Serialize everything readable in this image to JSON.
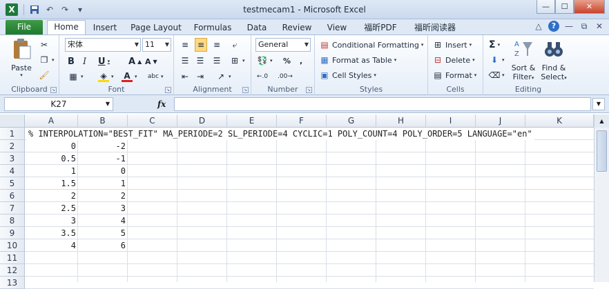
{
  "window": {
    "title": "testmecam1 - Microsoft Excel"
  },
  "app_icon": "X",
  "tabs": [
    "File",
    "Home",
    "Insert",
    "Page Layout",
    "Formulas",
    "Data",
    "Review",
    "View",
    "福昕PDF",
    "福昕阅读器"
  ],
  "clipboard": {
    "paste": "Paste",
    "label": "Clipboard"
  },
  "font": {
    "name": "宋体",
    "size": "11",
    "label": "Font"
  },
  "alignment": {
    "label": "Alignment"
  },
  "number": {
    "format": "General",
    "label": "Number"
  },
  "styles": {
    "conditional": "Conditional Formatting",
    "format_table": "Format as Table",
    "cell_styles": "Cell Styles",
    "label": "Styles"
  },
  "cells": {
    "insert": "Insert",
    "delete": "Delete",
    "format": "Format",
    "label": "Cells"
  },
  "editing": {
    "sort1": "Sort &",
    "sort2": "Filter",
    "find1": "Find &",
    "find2": "Select",
    "label": "Editing"
  },
  "formula_bar": {
    "name_box": "K27",
    "fx": "fx",
    "value": ""
  },
  "columns": [
    "A",
    "B",
    "C",
    "D",
    "E",
    "F",
    "G",
    "H",
    "I",
    "J",
    "K"
  ],
  "rows": [
    "1",
    "2",
    "3",
    "4",
    "5",
    "6",
    "7",
    "8",
    "9",
    "10",
    "11",
    "12",
    "13"
  ],
  "row1_text": "% INTERPOLATION=\"BEST_FIT\" MA_PERIODE=2 SL_PERIODE=4 CYCLIC=1 POLY_COUNT=4 POLY_ORDER=5 LANGUAGE=\"en\"",
  "data_a": [
    "0",
    "0.5",
    "1",
    "1.5",
    "2",
    "2.5",
    "3",
    "3.5",
    "4"
  ],
  "data_b": [
    "-2",
    "-1",
    "0",
    "1",
    "2",
    "3",
    "4",
    "5",
    "6"
  ]
}
